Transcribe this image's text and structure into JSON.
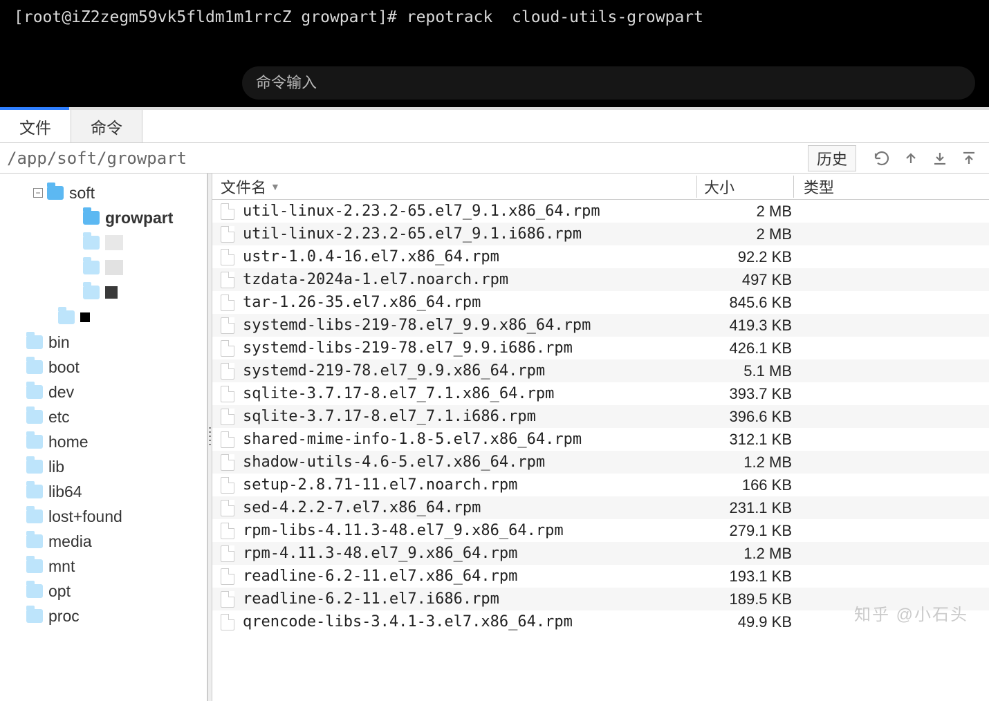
{
  "terminal": {
    "prompt": "[root@iZ2zegm59vk5fldm1m1rrcZ growpart]# repotrack  cloud-utils-growpart",
    "input_placeholder": "命令输入"
  },
  "tabs": {
    "file": "文件",
    "command": "命令"
  },
  "path_bar": {
    "path": "/app/soft/growpart",
    "history_label": "历史"
  },
  "columns": {
    "name": "文件名",
    "size": "大小",
    "type": "类型"
  },
  "tree": {
    "soft": "soft",
    "growpart": "growpart",
    "dirs": [
      "bin",
      "boot",
      "dev",
      "etc",
      "home",
      "lib",
      "lib64",
      "lost+found",
      "media",
      "mnt",
      "opt",
      "proc"
    ]
  },
  "files": [
    {
      "name": "util-linux-2.23.2-65.el7_9.1.x86_64.rpm",
      "size": "2 MB"
    },
    {
      "name": "util-linux-2.23.2-65.el7_9.1.i686.rpm",
      "size": "2 MB"
    },
    {
      "name": "ustr-1.0.4-16.el7.x86_64.rpm",
      "size": "92.2 KB"
    },
    {
      "name": "tzdata-2024a-1.el7.noarch.rpm",
      "size": "497 KB"
    },
    {
      "name": "tar-1.26-35.el7.x86_64.rpm",
      "size": "845.6 KB"
    },
    {
      "name": "systemd-libs-219-78.el7_9.9.x86_64.rpm",
      "size": "419.3 KB"
    },
    {
      "name": "systemd-libs-219-78.el7_9.9.i686.rpm",
      "size": "426.1 KB"
    },
    {
      "name": "systemd-219-78.el7_9.9.x86_64.rpm",
      "size": "5.1 MB"
    },
    {
      "name": "sqlite-3.7.17-8.el7_7.1.x86_64.rpm",
      "size": "393.7 KB"
    },
    {
      "name": "sqlite-3.7.17-8.el7_7.1.i686.rpm",
      "size": "396.6 KB"
    },
    {
      "name": "shared-mime-info-1.8-5.el7.x86_64.rpm",
      "size": "312.1 KB"
    },
    {
      "name": "shadow-utils-4.6-5.el7.x86_64.rpm",
      "size": "1.2 MB"
    },
    {
      "name": "setup-2.8.71-11.el7.noarch.rpm",
      "size": "166 KB"
    },
    {
      "name": "sed-4.2.2-7.el7.x86_64.rpm",
      "size": "231.1 KB"
    },
    {
      "name": "rpm-libs-4.11.3-48.el7_9.x86_64.rpm",
      "size": "279.1 KB"
    },
    {
      "name": "rpm-4.11.3-48.el7_9.x86_64.rpm",
      "size": "1.2 MB"
    },
    {
      "name": "readline-6.2-11.el7.x86_64.rpm",
      "size": "193.1 KB"
    },
    {
      "name": "readline-6.2-11.el7.i686.rpm",
      "size": "189.5 KB"
    },
    {
      "name": "qrencode-libs-3.4.1-3.el7.x86_64.rpm",
      "size": "49.9 KB"
    }
  ],
  "watermark": "知乎 @小石头"
}
